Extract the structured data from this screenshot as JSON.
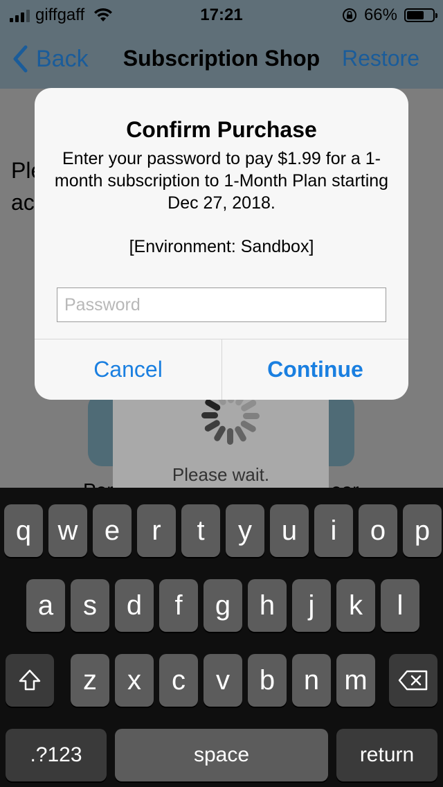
{
  "status": {
    "carrier": "giffgaff",
    "time": "17:21",
    "battery": "66%",
    "battery_level": 0.66
  },
  "nav": {
    "back": "Back",
    "title": "Subscription Shop",
    "restore": "Restore"
  },
  "background": {
    "line1": "Ple",
    "line2": "ac",
    "wait": "Please wait.",
    "under_left": "Per",
    "under_right": "ear"
  },
  "dialog": {
    "title": "Confirm Purchase",
    "message": "Enter your password to pay $1.99 for a 1-month subscription to 1-Month Plan starting Dec 27, 2018.",
    "environment": "[Environment: Sandbox]",
    "password_placeholder": "Password",
    "password_value": "",
    "cancel": "Cancel",
    "continue": "Continue"
  },
  "keyboard": {
    "row1": [
      "q",
      "w",
      "e",
      "r",
      "t",
      "y",
      "u",
      "i",
      "o",
      "p"
    ],
    "row2": [
      "a",
      "s",
      "d",
      "f",
      "g",
      "h",
      "j",
      "k",
      "l"
    ],
    "row3": [
      "z",
      "x",
      "c",
      "v",
      "b",
      "n",
      "m"
    ],
    "numbers": ".?123",
    "space": "space",
    "return": "return"
  }
}
